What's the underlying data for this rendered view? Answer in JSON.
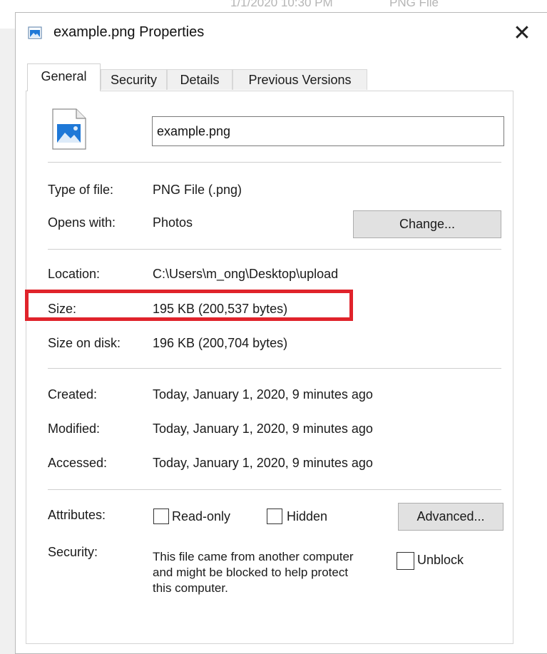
{
  "background_window": {
    "date_text": "1/1/2020 10:30 PM",
    "type_text": "PNG File"
  },
  "dialog": {
    "title": "example.png Properties",
    "close_glyph": "✕"
  },
  "tabs": [
    {
      "label": "General",
      "active": true
    },
    {
      "label": "Security",
      "active": false
    },
    {
      "label": "Details",
      "active": false
    },
    {
      "label": "Previous Versions",
      "active": false
    }
  ],
  "general": {
    "file_name": "example.png",
    "type_of_file": {
      "label": "Type of file:",
      "value": "PNG File (.png)"
    },
    "opens_with": {
      "label": "Opens with:",
      "value": "Photos",
      "button": "Change..."
    },
    "location": {
      "label": "Location:",
      "value": "C:\\Users\\m_ong\\Desktop\\upload"
    },
    "size": {
      "label": "Size:",
      "value": "195 KB (200,537 bytes)"
    },
    "size_on_disk": {
      "label": "Size on disk:",
      "value": "196 KB (200,704 bytes)"
    },
    "created": {
      "label": "Created:",
      "value": "Today, January 1, 2020, 9 minutes ago"
    },
    "modified": {
      "label": "Modified:",
      "value": "Today, January 1, 2020, 9 minutes ago"
    },
    "accessed": {
      "label": "Accessed:",
      "value": "Today, January 1, 2020, 9 minutes ago"
    },
    "attributes": {
      "label": "Attributes:",
      "read_only": "Read-only",
      "hidden": "Hidden",
      "advanced_button": "Advanced..."
    },
    "security": {
      "label": "Security:",
      "line1": "This file came from another computer",
      "line2": "and might be blocked to help protect",
      "line3": "this computer.",
      "unblock": "Unblock"
    }
  },
  "colors": {
    "highlight": "#e0232b",
    "icon_blue": "#1e78d7"
  }
}
